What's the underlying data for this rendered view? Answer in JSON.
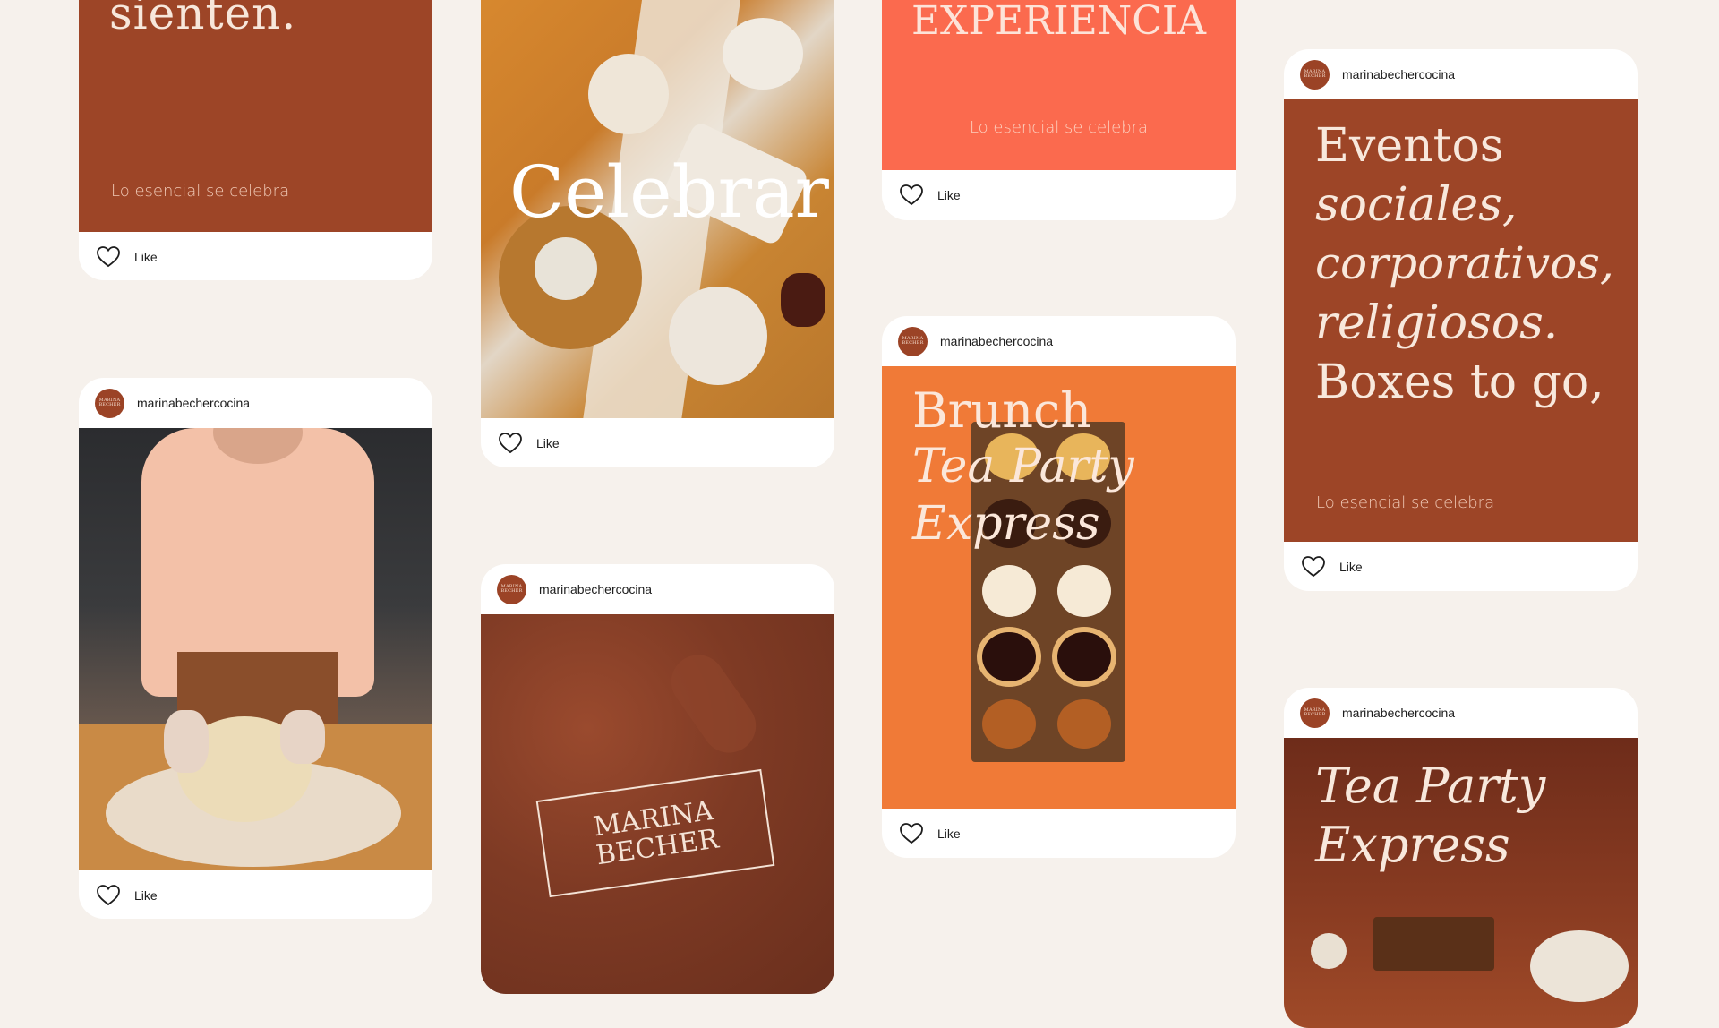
{
  "account": {
    "username": "marinabechercocina",
    "avatar_text_line1": "MARINA",
    "avatar_text_line2": "BECHER"
  },
  "like_label": "Like",
  "tagline": "Lo esencial se celebra",
  "posts": {
    "p1": {
      "headline": "sienten.",
      "bg": "#9d4527"
    },
    "p2": {
      "headline": "Celebrar",
      "photo": "party-table-photo"
    },
    "p3": {
      "headline": "EXPERIENCIA",
      "bg": "#fb6a4e"
    },
    "p4": {
      "line1": "Eventos",
      "line2": "sociales,",
      "line3": "corporativos,",
      "line4": "religiosos.",
      "line5": "Boxes to go,",
      "bg": "#9d4527"
    },
    "p5": {
      "photo": "baker-kneading-dough-photo"
    },
    "p6": {
      "line1": "Brunch",
      "line2": "Tea Party",
      "line3": "Express",
      "bg": "#f07a37"
    },
    "p7": {
      "logo_line1": "MARINA",
      "logo_line2": "BECHER",
      "photo": "cocoa-powder-photo"
    },
    "p8": {
      "line1": "Tea Party",
      "line2": "Express",
      "bg": "#7b3320"
    }
  },
  "colors": {
    "background": "#f6f1ec",
    "brand_brown": "#9d4527",
    "coral": "#fb6a4e",
    "orange": "#f07a37"
  }
}
